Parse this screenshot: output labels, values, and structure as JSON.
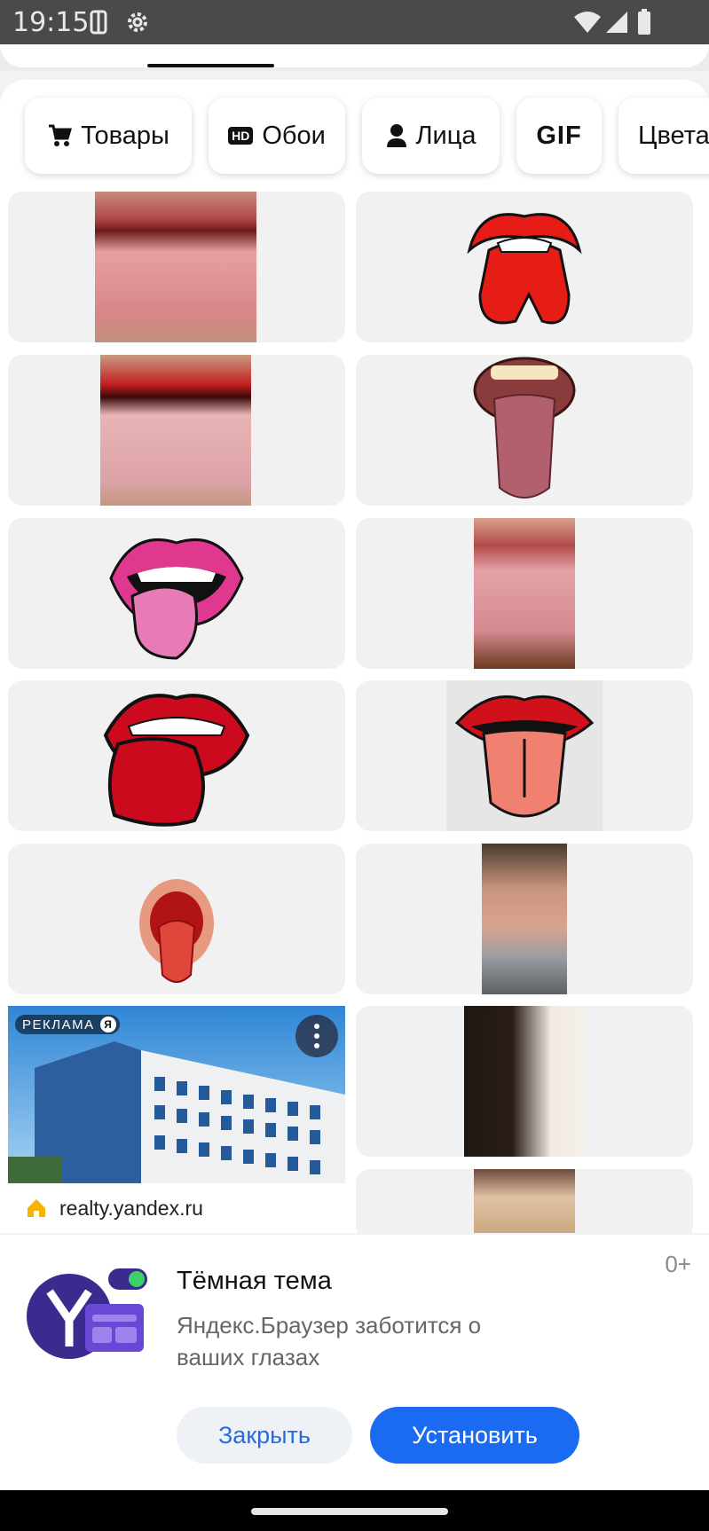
{
  "status_bar": {
    "time": "19:15"
  },
  "chips": [
    {
      "label": "Товары",
      "icon": "cart-icon"
    },
    {
      "label": "Обои",
      "icon": "hd-icon",
      "badge": "HD"
    },
    {
      "label": "Лица",
      "icon": "person-icon"
    },
    {
      "label": "GIF"
    },
    {
      "label": "Цвета"
    }
  ],
  "ad": {
    "label": "РЕКЛАМА",
    "badge": "Я",
    "domain": "realty.yandex.ru"
  },
  "banner": {
    "title": "Тёмная тема",
    "subtitle": "Яндекс.Браузер заботится о ваших глазах",
    "age_rating": "0+",
    "close_label": "Закрыть",
    "install_label": "Установить"
  }
}
